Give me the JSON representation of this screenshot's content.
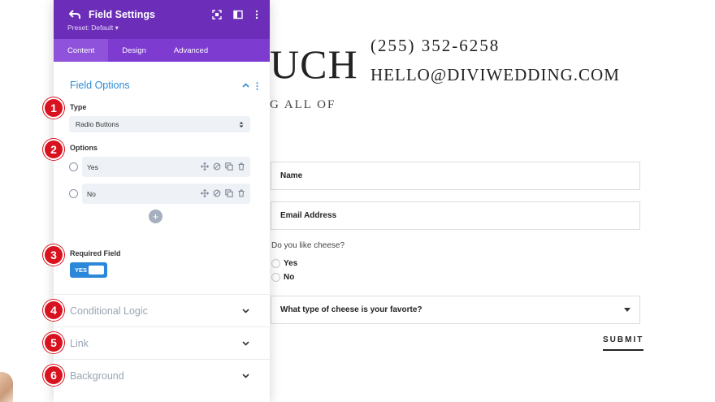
{
  "page": {
    "heading_fragment": "UCH",
    "subheading_fragment": "G ALL OF",
    "phone": "(255)  352-6258",
    "email": "HELLO@DIVIWEDDING.COM",
    "form": {
      "name_placeholder": "Name",
      "email_placeholder": "Email Address",
      "question": "Do you like cheese?",
      "radio_options": [
        "Yes",
        "No"
      ],
      "select_label": "What type of cheese is your favorte?",
      "submit_label": "SUBMIT"
    }
  },
  "panel": {
    "title": "Field Settings",
    "preset": "Preset: Default ▾",
    "tabs": [
      "Content",
      "Design",
      "Advanced"
    ],
    "active_tab": "Content",
    "section_title": "Field Options",
    "type_label": "Type",
    "type_value": "Radio Buttons",
    "options_label": "Options",
    "options": [
      "Yes",
      "No"
    ],
    "add_label": "+",
    "required_label": "Required Field",
    "required_toggle": "YES",
    "collapsed_sections": [
      "Conditional Logic",
      "Link",
      "Background"
    ]
  },
  "markers": [
    "1",
    "2",
    "3",
    "4",
    "5",
    "6"
  ],
  "colors": {
    "header_purple": "#6c2eb9",
    "tab_purple": "#7d3bd0",
    "accent_blue": "#2e8bd6",
    "toggle_blue": "#2b87da",
    "marker_red": "#d8131f"
  },
  "icons": {
    "back": "undo-arrow-icon",
    "header_right": [
      "expand-icon",
      "split-view-icon",
      "kebab-menu-icon"
    ],
    "option_actions": [
      "move-icon",
      "disable-icon",
      "duplicate-icon",
      "trash-icon"
    ]
  }
}
